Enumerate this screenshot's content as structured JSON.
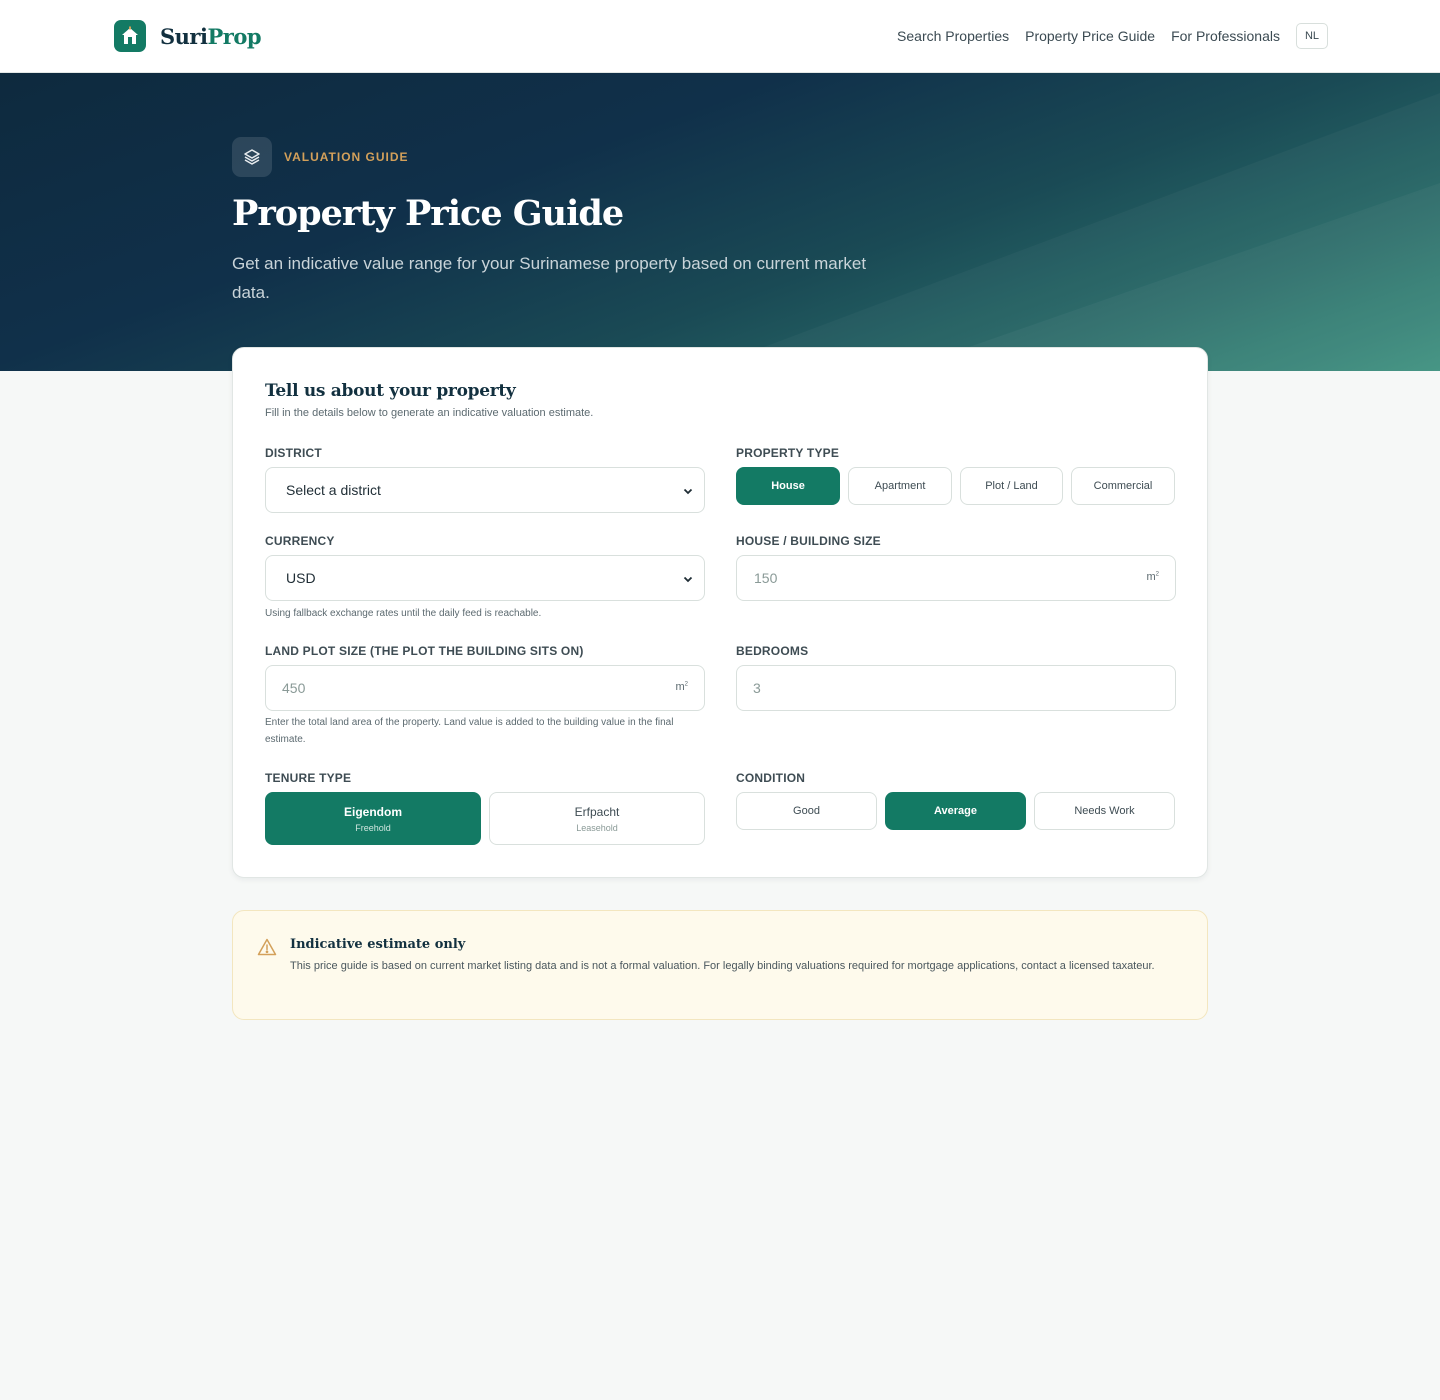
{
  "header": {
    "brand_part1": "Suri",
    "brand_part2": "Prop",
    "nav": [
      "Search Properties",
      "Property Price Guide",
      "For Professionals"
    ],
    "lang": "NL"
  },
  "hero": {
    "badge": "VALUATION GUIDE",
    "title": "Property Price Guide",
    "subtitle": "Get an indicative value range for your Surinamese property based on current market data."
  },
  "form": {
    "title": "Tell us about your property",
    "subtitle": "Fill in the details below to generate an indicative valuation estimate.",
    "district": {
      "label": "DISTRICT",
      "value": "Select a district"
    },
    "property_type": {
      "label": "PROPERTY TYPE",
      "options": [
        "House",
        "Apartment",
        "Plot / Land",
        "Commercial"
      ],
      "selected": "House"
    },
    "currency": {
      "label": "CURRENCY",
      "value": "USD",
      "hint": "Using fallback exchange rates until the daily feed is reachable."
    },
    "building_size": {
      "label": "HOUSE / BUILDING SIZE",
      "placeholder": "150",
      "unit": "m",
      "unit_sup": "2"
    },
    "land_size": {
      "label": "LAND PLOT SIZE (THE PLOT THE BUILDING SITS ON)",
      "placeholder": "450",
      "unit": "m",
      "unit_sup": "2",
      "hint": "Enter the total land area of the property. Land value is added to the building value in the final estimate."
    },
    "bedrooms": {
      "label": "BEDROOMS",
      "placeholder": "3"
    },
    "tenure": {
      "label": "TENURE TYPE",
      "options": [
        {
          "title": "Eigendom",
          "sub": "Freehold"
        },
        {
          "title": "Erfpacht",
          "sub": "Leasehold"
        }
      ],
      "selected": "Eigendom"
    },
    "condition": {
      "label": "CONDITION",
      "options": [
        "Good",
        "Average",
        "Needs Work"
      ],
      "selected": "Average"
    }
  },
  "notice": {
    "title": "Indicative estimate only",
    "body": "This price guide is based on current market listing data and is not a formal valuation. For legally binding valuations required for mortgage applications, contact a licensed taxateur."
  },
  "colors": {
    "brand": "#137a64",
    "navy": "#12303f",
    "accent": "#d3a05a",
    "notice_bg": "#fefaec"
  },
  "icons": [
    "home-logo-icon",
    "layers-icon",
    "chevron-down-icon",
    "warning-icon"
  ]
}
